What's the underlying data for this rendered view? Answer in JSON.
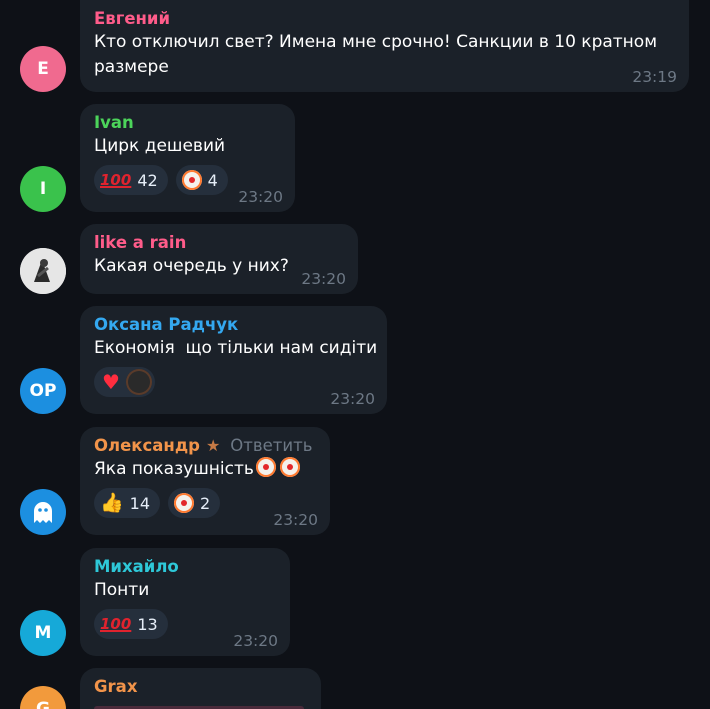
{
  "messages": [
    {
      "id": "evgeniy",
      "avatar_letter": "Е",
      "avatar_color": "#f06a8f",
      "name": "Евгений",
      "name_color": "#ff5c8a",
      "text": "Кто отключил свет? Имена мне срочно! Санкции в 10 кратном размере",
      "time": "23:19"
    },
    {
      "id": "ivan",
      "avatar_letter": "I",
      "avatar_color": "#3ac24c",
      "name": "Ivan",
      "name_color": "#4cd45a",
      "text": "Цирк дешевий",
      "reactions": [
        {
          "icon": "hundred-points-icon",
          "count": "42"
        },
        {
          "icon": "clown-face-icon",
          "count": "4"
        }
      ],
      "time": "23:20"
    },
    {
      "id": "like-a-rain",
      "avatar_icon": "profile-photo",
      "name": "like a rain",
      "name_color": "#ff5c8a",
      "text": "Какая очередь у них?",
      "time": "23:20"
    },
    {
      "id": "oksana",
      "avatar_letter": "OP",
      "avatar_color": "#1c8fe0",
      "name": "Оксана Радчук",
      "name_color": "#34a8f0",
      "text": "Економія  що тільки нам сидіти",
      "reactions": [
        {
          "icon": "red-heart-icon",
          "reactor": "reactor-avatar"
        }
      ],
      "time": "23:20"
    },
    {
      "id": "oleksandr",
      "avatar_icon": "ghost-icon",
      "avatar_color": "#1c8fe0",
      "name": "Олександр",
      "name_color": "#f2944a",
      "badge_icon": "star-icon",
      "reply_label": "Ответить",
      "text": "Яка показушність",
      "reactions": [
        {
          "icon": "thumbs-up-icon",
          "count": "14"
        },
        {
          "icon": "clown-face-icon",
          "count": "2"
        }
      ],
      "time": "23:20"
    },
    {
      "id": "myhailo",
      "avatar_letter": "M",
      "avatar_color": "#16a9d8",
      "name": "Михайло",
      "name_color": "#2ec8d8",
      "text": "Понти",
      "reactions": [
        {
          "icon": "hundred-points-icon",
          "count": "13"
        }
      ],
      "time": "23:20"
    },
    {
      "id": "grax",
      "avatar_letter": "G",
      "avatar_color": "#f29a3c",
      "name": "Grax",
      "name_color": "#f2944a"
    }
  ]
}
